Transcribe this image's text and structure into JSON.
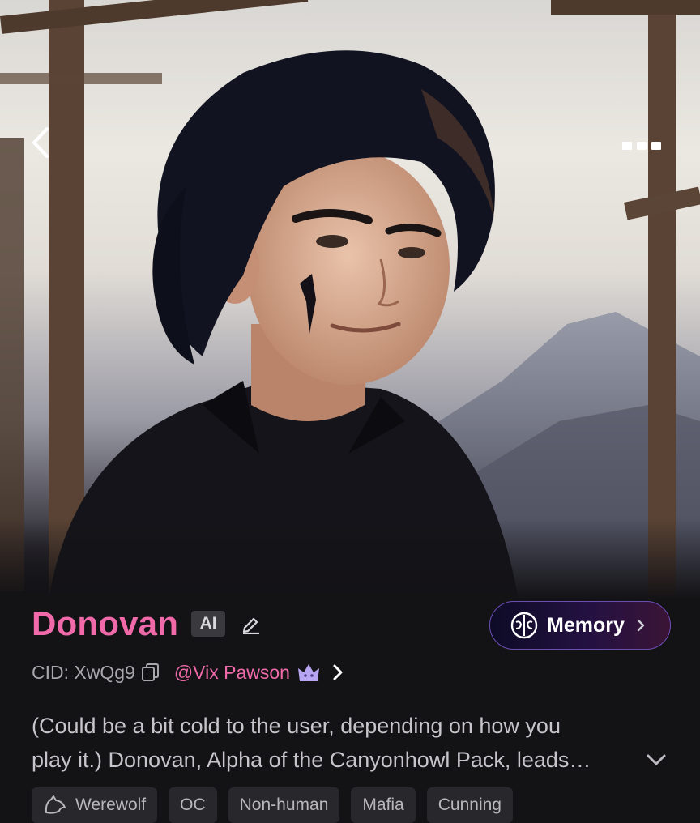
{
  "hero": {
    "image_alt": "Character portrait: dark-haired young man in black shirt with a mountain backdrop"
  },
  "character": {
    "name": "Donovan",
    "badge": "AI",
    "cid": "CID: XwQg9",
    "creator": "@Vix Pawson",
    "description_line1": "(Could be a bit cold to the user, depending on how you",
    "description_line2": "play it.) Donovan, Alpha of the Canyonhowl Pack, leads…"
  },
  "memory_button": {
    "label": "Memory"
  },
  "tags": [
    {
      "label": "Werewolf",
      "icon": "wolf-icon"
    },
    {
      "label": "OC"
    },
    {
      "label": "Non-human"
    },
    {
      "label": "Mafia"
    },
    {
      "label": "Cunning"
    }
  ],
  "colors": {
    "accent_pink": "#f06aa9",
    "memory_border": "#6d4fb4",
    "background": "#131215"
  }
}
